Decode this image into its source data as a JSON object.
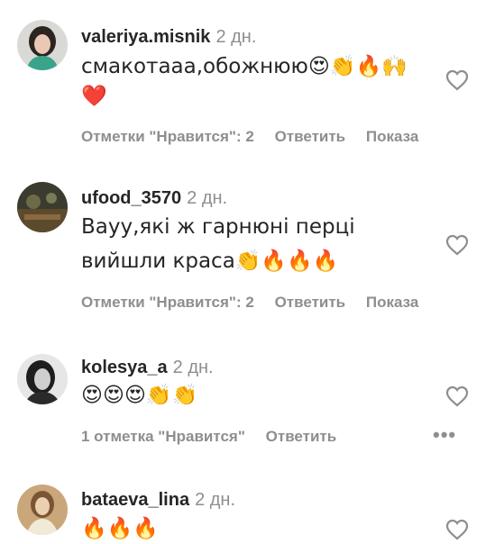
{
  "comments": [
    {
      "username": "valeriya.misnik",
      "time": "2 дн.",
      "text_line1": "смакотааа,обожнюю😍👏🔥🙌",
      "text_line2": "❤️",
      "likes": "Отметки \"Нравится\": 2",
      "reply": "Ответить",
      "show": "Показа"
    },
    {
      "username": "ufood_3570",
      "time": "2 дн.",
      "text_line1": "Вауу,які ж гарнюні перці",
      "text_line2": "вийшли краса👏🔥🔥🔥",
      "likes": "Отметки \"Нравится\": 2",
      "reply": "Ответить",
      "show": "Показа"
    },
    {
      "username": "kolesya_a",
      "time": "2 дн.",
      "text_line1": "😍😍😍👏👏",
      "likes": "1 отметка \"Нравится\"",
      "reply": "Ответить",
      "more": "•••"
    },
    {
      "username": "bataeva_lina",
      "time": "2 дн.",
      "text_line1": "🔥🔥🔥"
    }
  ],
  "icons": {
    "like": "heart-outline-icon",
    "options": "more-options-icon"
  },
  "colors": {
    "text": "#262626",
    "secondary": "#8e8e8e",
    "background": "#ffffff"
  }
}
